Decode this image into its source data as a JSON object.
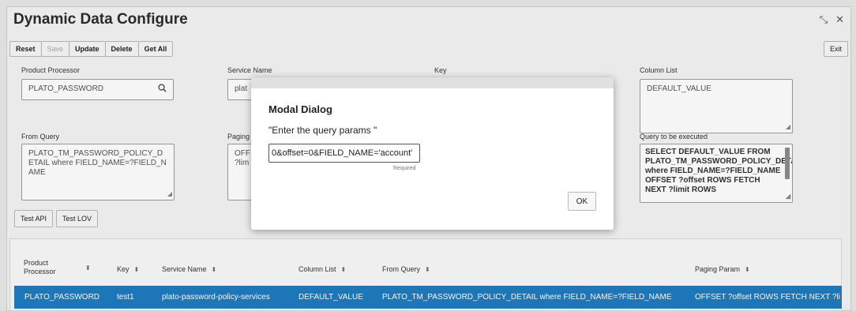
{
  "window": {
    "title": "Dynamic Data Configure",
    "minimize_glyph": "⤡",
    "close_glyph": "✕"
  },
  "toolbar": {
    "reset": "Reset",
    "save": "Save",
    "update": "Update",
    "delete": "Delete",
    "get_all": "Get All",
    "exit": "Exit"
  },
  "form": {
    "product_processor": {
      "label": "Product Processor",
      "value": "PLATO_PASSWORD"
    },
    "service_name": {
      "label": "Service Name",
      "value": "plat"
    },
    "key": {
      "label": "Key"
    },
    "column_list": {
      "label": "Column List",
      "value": "DEFAULT_VALUE"
    },
    "from_query": {
      "label": "From Query",
      "value": "PLATO_TM_PASSWORD_POLICY_DETAIL where FIELD_NAME=?FIELD_NAME"
    },
    "paging": {
      "label": "Paging",
      "value": "OFF ?lim"
    },
    "query_exec": {
      "label": "Query to be executed",
      "value": "SELECT DEFAULT_VALUE FROM PLATO_TM_PASSWORD_POLICY_DETAIL where FIELD_NAME=?FIELD_NAME OFFSET ?offset ROWS FETCH NEXT ?limit ROWS"
    }
  },
  "tests": {
    "api": "Test API",
    "lov": "Test LOV"
  },
  "table": {
    "headers": {
      "product_processor": "Product Processor",
      "key": "Key",
      "service_name": "Service Name",
      "column_list": "Column List",
      "from_query": "From Query",
      "paging_param": "Paging Param"
    },
    "row": {
      "product_processor": "PLATO_PASSWORD",
      "key": "test1",
      "service_name": "plato-password-policy-services",
      "column_list": "DEFAULT_VALUE",
      "from_query": "PLATO_TM_PASSWORD_POLICY_DETAIL where FIELD_NAME=?FIELD_NAME",
      "paging_param": "OFFSET ?offset ROWS FETCH NEXT ?li"
    }
  },
  "modal": {
    "title": "Modal Dialog",
    "prompt": "\"Enter the query params \"",
    "input_value": "0&offset=0&FIELD_NAME='account'",
    "required": "Required",
    "ok": "OK"
  },
  "colors": {
    "row_selected": "#1f7bbf",
    "modal_header": "#e0e0e0"
  }
}
